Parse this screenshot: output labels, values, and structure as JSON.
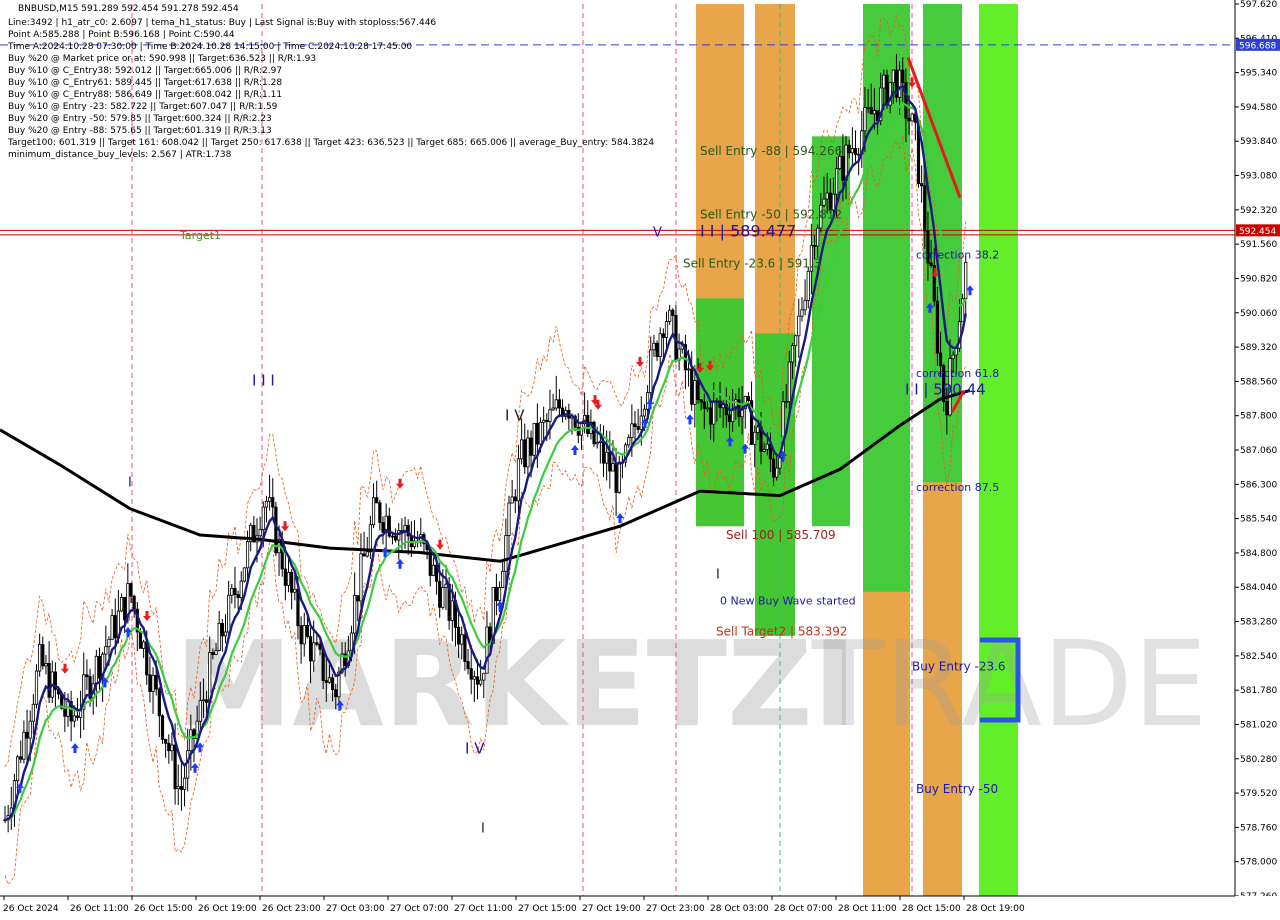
{
  "header": {
    "symbol_line": "BNBUSD,M15  591.289 592.454 591.278 592.454",
    "lines": [
      "Line:3492 | h1_atr_c0: 2.6097 | tema_h1_status: Buy | Last Signal is:Buy with stoploss:567.446",
      "Point A:585.288 | Point B:596.168 | Point C:590.44",
      "Time A:2024.10.28 07:30:00 | Time B:2024.10.28 14:15:00 | Time C:2024.10.28 17:45:00",
      "Buy %20 @ Market price or at: 590.998 || Target:636.523 || R/R:1.93",
      "Buy %10 @ C_Entry38: 592.012 || Target:665.006 || R/R:2.97",
      "Buy %10 @ C_Entry61: 589.445 || Target:617.638 || R/R:1.28",
      "Buy %10 @ C_Entry88: 586.649 || Target:608.042 || R/R:1.11",
      "Buy %10 @ Entry -23: 582.722 || Target:607.047 || R/R:1.59",
      "Buy %20 @ Entry -50: 579.85 || Target:600.324 || R/R:2.23",
      "Buy %20 @ Entry -88: 575.65 || Target:601.319 || R/R:3.13",
      "Target100: 601.319 || Target 161: 608.042 || Target 250: 617.638 || Target 423: 636.523 || Target 685: 665.006 || average_Buy_entry: 584.3824",
      "minimum_distance_buy_levels: 2.567 | ATR:1.738"
    ]
  },
  "watermark": {
    "left": "MARKETZI",
    "right": "TRADE"
  },
  "chart_data": {
    "type": "candlestick",
    "symbol": "BNBUSD",
    "timeframe": "M15",
    "ohlc_last": {
      "open": 591.289,
      "high": 592.454,
      "low": 591.278,
      "close": 592.454
    },
    "ylim": [
      577.26,
      597.62
    ],
    "y_ticks": [
      "597.620",
      "596.410",
      "595.340",
      "594.580",
      "593.840",
      "593.080",
      "592.320",
      "591.560",
      "590.820",
      "590.060",
      "589.320",
      "588.560",
      "587.800",
      "587.060",
      "586.300",
      "585.540",
      "584.800",
      "584.040",
      "583.280",
      "582.540",
      "581.780",
      "581.020",
      "580.280",
      "579.520",
      "578.760",
      "578.000",
      "577.260"
    ],
    "x_tick_labels": [
      "26 Oct 2024",
      "26 Oct 11:00",
      "26 Oct 15:00",
      "26 Oct 19:00",
      "26 Oct 23:00",
      "27 Oct 03:00",
      "27 Oct 07:00",
      "27 Oct 11:00",
      "27 Oct 15:00",
      "27 Oct 19:00",
      "27 Oct 23:00",
      "28 Oct 03:00",
      "28 Oct 07:00",
      "28 Oct 11:00",
      "28 Oct 15:00",
      "28 Oct 19:00"
    ],
    "price_tags": [
      {
        "label": "596.688",
        "value": 596.688,
        "color": "#2f3fd6"
      },
      {
        "label": "592.454",
        "value": 592.454,
        "color": "#cc0000"
      }
    ],
    "horizontal_lines": [
      {
        "name": "stop-break",
        "value": 596.688,
        "style": "dashed",
        "color": "#2f3fd6"
      },
      {
        "name": "target1",
        "value": 592.35,
        "style": "solid",
        "color": "#cc0000"
      },
      {
        "name": "current-price",
        "value": 592.454,
        "style": "solid",
        "color": "#cc0000"
      }
    ],
    "zones": [
      {
        "name": "sell-zone-orange-1",
        "t0": 696,
        "t1": 744,
        "y0": 597.62,
        "y1": 585.7,
        "color": "#e8a040"
      },
      {
        "name": "sell-zone-green-1",
        "t0": 696,
        "t1": 744,
        "y0": 590.9,
        "y1": 585.7,
        "color": "#3cc832"
      },
      {
        "name": "sell-zone-orange-2",
        "t0": 755,
        "t1": 795,
        "y0": 597.62,
        "y1": 583.2,
        "color": "#e8a040"
      },
      {
        "name": "sell-zone-green-2",
        "t0": 755,
        "t1": 795,
        "y0": 590.1,
        "y1": 583.2,
        "color": "#3cc832"
      },
      {
        "name": "buy-zone-green-1",
        "t0": 812,
        "t1": 850,
        "y0": 594.6,
        "y1": 585.7,
        "color": "#3cc832"
      },
      {
        "name": "buy-zone-green-2",
        "t0": 863,
        "t1": 910,
        "y0": 597.62,
        "y1": 584.2,
        "color": "#3cc832"
      },
      {
        "name": "buy-zone-orange-2",
        "t0": 863,
        "t1": 910,
        "y0": 584.2,
        "y1": 577.26,
        "color": "#e8a040"
      },
      {
        "name": "buy-zone-green-3",
        "t0": 923,
        "t1": 962,
        "y0": 597.62,
        "y1": 586.7,
        "color": "#3cc832"
      },
      {
        "name": "buy-zone-orange-3",
        "t0": 923,
        "t1": 962,
        "y0": 586.7,
        "y1": 577.26,
        "color": "#e8a040"
      },
      {
        "name": "buy-zone-lime",
        "t0": 979,
        "t1": 1018,
        "y0": 597.62,
        "y1": 577.26,
        "color": "#5aee1e"
      }
    ],
    "annotations": [
      {
        "text": "Target1",
        "value": 592.35,
        "color": "#3a9a1a"
      },
      {
        "text": "Sell Entry -88 | 594.266",
        "value": 594.266,
        "color": "#2a5a1a"
      },
      {
        "text": "Sell Entry -50 | 592.812",
        "value": 592.812,
        "color": "#2a5a1a"
      },
      {
        "text": "I I | 589.477",
        "value": 592.4,
        "color": "#1a1a9a"
      },
      {
        "text": "Sell Entry -23.6 | 591.3",
        "value": 591.7,
        "color": "#2a5a1a"
      },
      {
        "text": "Sell 100 | 585.709",
        "value": 585.5,
        "color": "#a02020"
      },
      {
        "text": "0 New Buy Wave started",
        "value": 584.0,
        "color": "#1a1aaa"
      },
      {
        "text": "Sell Target2 | 583.392",
        "value": 583.3,
        "color": "#c03020"
      },
      {
        "text": "correction 38.2",
        "value": 591.9,
        "color": "#1a1aaa"
      },
      {
        "text": "correction 61.8",
        "value": 589.2,
        "color": "#1a1aaa"
      },
      {
        "text": "I I | 590.44",
        "value": 588.8,
        "color": "#1a1aaa"
      },
      {
        "text": "correction 87.5",
        "value": 586.6,
        "color": "#1a1aaa"
      },
      {
        "text": "Buy Entry -23.6",
        "value": 582.5,
        "color": "#1a1aaa"
      },
      {
        "text": "Buy Entry -50",
        "value": 579.7,
        "color": "#1a1aaa"
      },
      {
        "text": "I I I",
        "value": 589.0,
        "color": "#1a1aaa"
      },
      {
        "text": "I V",
        "value": 588.2,
        "color": "#222222"
      },
      {
        "text": "I V",
        "value": 580.6,
        "color": "#1a1aaa"
      },
      {
        "text": "I",
        "value": 586.7,
        "color": "#1a1aaa"
      },
      {
        "text": "I",
        "value": 584.6,
        "color": "#222222"
      },
      {
        "text": "I",
        "value": 578.8,
        "color": "#222222"
      },
      {
        "text": "V",
        "value": 592.4,
        "color": "#1a1aaa"
      }
    ],
    "colors": {
      "up_candle": "#000000",
      "down_candle": "#000000",
      "ema_fast": "#1a1a80",
      "ema_mid": "#3ccc3c",
      "ema_slow": "#000000",
      "channel": "#e85a1a",
      "buy_arrow": "#1a3aff",
      "sell_arrow": "#e81a1a"
    }
  }
}
